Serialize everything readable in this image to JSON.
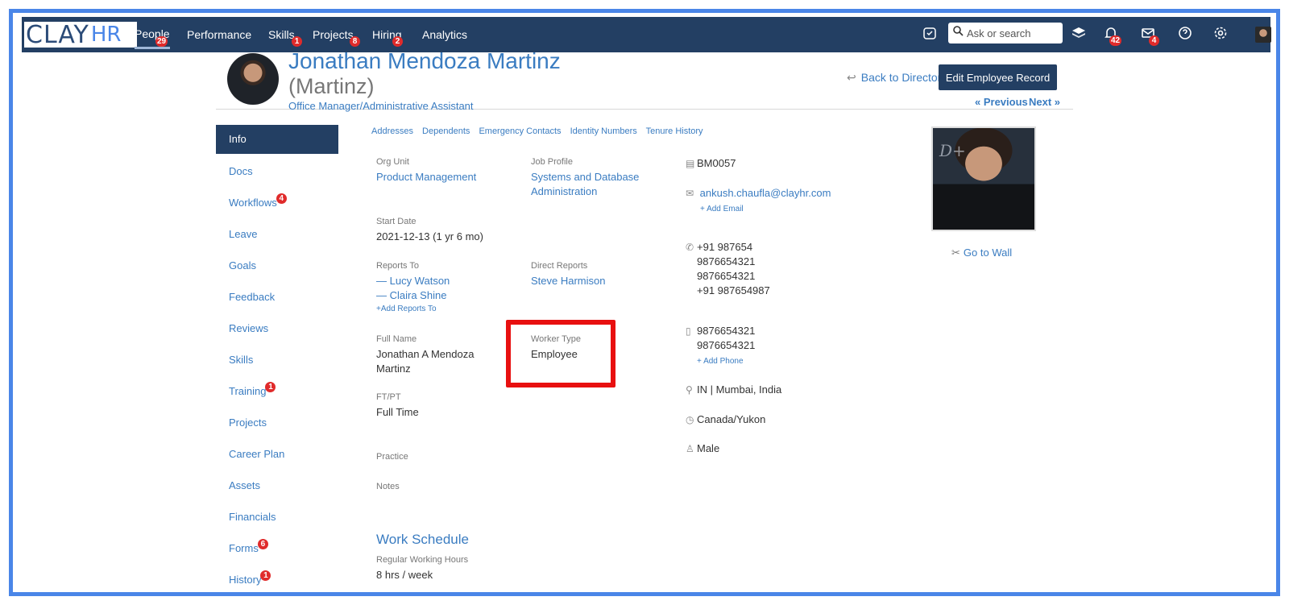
{
  "nav": {
    "logo_main": "CLAY",
    "logo_sub": "HR",
    "items": [
      {
        "label": "People",
        "badge": "29"
      },
      {
        "label": "Performance",
        "badge": ""
      },
      {
        "label": "Skills",
        "badge": "1"
      },
      {
        "label": "Projects",
        "badge": "8"
      },
      {
        "label": "Hiring",
        "badge": "2"
      },
      {
        "label": "Analytics",
        "badge": ""
      }
    ],
    "search_placeholder": "Ask or search",
    "notifications_badge": "42",
    "messages_badge": "4"
  },
  "header": {
    "name": "Jonathan Mendoza Martinz",
    "nickname": "(Martinz)",
    "job_title": "Office Manager/Administrative Assistant",
    "back_label": "Back to Directory",
    "edit_label": "Edit Employee Record",
    "prev_label": "« Previous",
    "next_label": "Next »"
  },
  "sidebar": {
    "items": [
      {
        "label": "Info",
        "badge": ""
      },
      {
        "label": "Docs",
        "badge": ""
      },
      {
        "label": "Workflows",
        "badge": "4"
      },
      {
        "label": "Leave",
        "badge": ""
      },
      {
        "label": "Goals",
        "badge": ""
      },
      {
        "label": "Feedback",
        "badge": ""
      },
      {
        "label": "Reviews",
        "badge": ""
      },
      {
        "label": "Skills",
        "badge": ""
      },
      {
        "label": "Training",
        "badge": "1"
      },
      {
        "label": "Projects",
        "badge": ""
      },
      {
        "label": "Career Plan",
        "badge": ""
      },
      {
        "label": "Assets",
        "badge": ""
      },
      {
        "label": "Financials",
        "badge": ""
      },
      {
        "label": "Forms",
        "badge": "6"
      },
      {
        "label": "History",
        "badge": "1"
      }
    ]
  },
  "subtabs": [
    "Addresses",
    "Dependents",
    "Emergency Contacts",
    "Identity Numbers",
    "Tenure History"
  ],
  "fields": {
    "org_unit": {
      "label": "Org Unit",
      "value": "Product Management"
    },
    "job_profile": {
      "label": "Job Profile",
      "value_line1": "Systems and Database",
      "value_line2": "Administration"
    },
    "start_date": {
      "label": "Start Date",
      "value": "2021-12-13 (1 yr 6 mo)"
    },
    "reports_to": {
      "label": "Reports To",
      "people": [
        "— Lucy Watson",
        "— Claira Shine"
      ],
      "add_label": "+Add Reports To"
    },
    "direct_reports": {
      "label": "Direct Reports",
      "value": "Steve Harmison"
    },
    "full_name": {
      "label": "Full Name",
      "value_line1": "Jonathan A Mendoza",
      "value_line2": "Martinz"
    },
    "worker_type": {
      "label": "Worker Type",
      "value": "Employee"
    },
    "ft_pt": {
      "label": "FT/PT",
      "value": "Full Time"
    },
    "practice": {
      "label": "Practice"
    },
    "notes": {
      "label": "Notes"
    }
  },
  "contact": {
    "employee_id": "BM0057",
    "email": "ankush.chaufla@clayhr.com",
    "add_email": "+ Add Email",
    "phones": [
      "+91 987654",
      "9876654321",
      "9876654321",
      "+91 987654987"
    ],
    "mobiles": [
      "9876654321",
      "9876654321"
    ],
    "add_phone": "+ Add Phone",
    "location": "IN | Mumbai, India",
    "timezone": "Canada/Yukon",
    "gender": "Male"
  },
  "profile": {
    "photo_watermark": "D+",
    "go_wall_label": "Go to Wall"
  },
  "work_schedule": {
    "heading": "Work Schedule",
    "label": "Regular Working Hours",
    "value": "8 hrs / week"
  }
}
